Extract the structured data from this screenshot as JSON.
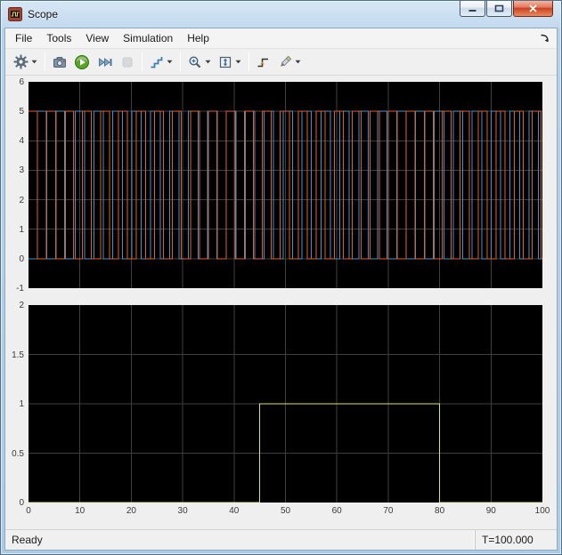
{
  "window": {
    "title": "Scope"
  },
  "titlebar_controls": {
    "minimize": "minimize",
    "maximize": "maximize",
    "close": "close"
  },
  "menubar": {
    "items": [
      {
        "label": "File"
      },
      {
        "label": "Tools"
      },
      {
        "label": "View"
      },
      {
        "label": "Simulation"
      },
      {
        "label": "Help"
      }
    ]
  },
  "toolbar": {
    "items": [
      {
        "id": "configuration",
        "icon": "gear-icon",
        "dropdown": true
      },
      {
        "separator": true
      },
      {
        "id": "snapshot",
        "icon": "camera-icon"
      },
      {
        "id": "run",
        "icon": "play-icon"
      },
      {
        "id": "step-forward",
        "icon": "step-forward-icon"
      },
      {
        "id": "stop",
        "icon": "stop-icon",
        "disabled": true
      },
      {
        "separator": true
      },
      {
        "id": "stepping-options",
        "icon": "stairs-icon",
        "dropdown": true
      },
      {
        "separator": true
      },
      {
        "id": "zoom",
        "icon": "zoom-in-icon",
        "dropdown": true
      },
      {
        "id": "fit-to-view",
        "icon": "fit-to-view-icon",
        "dropdown": true
      },
      {
        "separator": true
      },
      {
        "id": "triggers",
        "icon": "trigger-icon"
      },
      {
        "id": "cursor-measurements",
        "icon": "measurements-icon",
        "dropdown": true
      }
    ]
  },
  "statusbar": {
    "status": "Ready",
    "time": "T=100.000"
  },
  "chart_data": [
    {
      "name": "display-1",
      "type": "line",
      "title": "",
      "xlabel": "",
      "ylabel": "",
      "background": "#000000",
      "grid": true,
      "grid_color": "#3f3f3f",
      "xlim": [
        0,
        100
      ],
      "ylim": [
        -1,
        6
      ],
      "xticks": [
        0,
        10,
        20,
        30,
        40,
        50,
        60,
        70,
        80,
        90,
        100
      ],
      "xtick_labels": [],
      "yticks": [
        -1,
        0,
        1,
        2,
        3,
        4,
        5,
        6
      ],
      "ytick_labels": [
        "-1",
        "0",
        "1",
        "2",
        "3",
        "4",
        "5",
        "6"
      ],
      "legend": false,
      "series": [
        {
          "name": "pulse-channel-blue",
          "color": "#4a90c8",
          "waveform": "square",
          "period": 3.68,
          "duty": 0.5,
          "phase": 1.7,
          "low": 0,
          "high": 5
        },
        {
          "name": "pulse-channel-orange",
          "color": "#e05f2b",
          "waveform": "square",
          "period": 3.5,
          "duty": 0.5,
          "phase": 0,
          "low": 0,
          "high": 5
        }
      ]
    },
    {
      "name": "display-2",
      "type": "line",
      "title": "",
      "xlabel": "",
      "ylabel": "",
      "background": "#000000",
      "grid": true,
      "grid_color": "#3f3f3f",
      "xlim": [
        0,
        100
      ],
      "ylim": [
        0,
        2
      ],
      "xticks": [
        0,
        10,
        20,
        30,
        40,
        50,
        60,
        70,
        80,
        90,
        100
      ],
      "xtick_labels": [
        "0",
        "10",
        "20",
        "30",
        "40",
        "50",
        "60",
        "70",
        "80",
        "90",
        "100"
      ],
      "yticks": [
        0,
        0.5,
        1,
        1.5,
        2
      ],
      "ytick_labels": [
        "0",
        "0.5",
        "1",
        "1.5",
        "2"
      ],
      "legend": false,
      "series": [
        {
          "name": "gate-channel-yellow",
          "color": "#e8e352",
          "waveform": "steps",
          "points": [
            [
              0,
              0
            ],
            [
              45,
              0
            ],
            [
              45,
              1
            ],
            [
              80,
              1
            ],
            [
              80,
              0
            ],
            [
              100,
              0
            ]
          ]
        }
      ]
    }
  ]
}
